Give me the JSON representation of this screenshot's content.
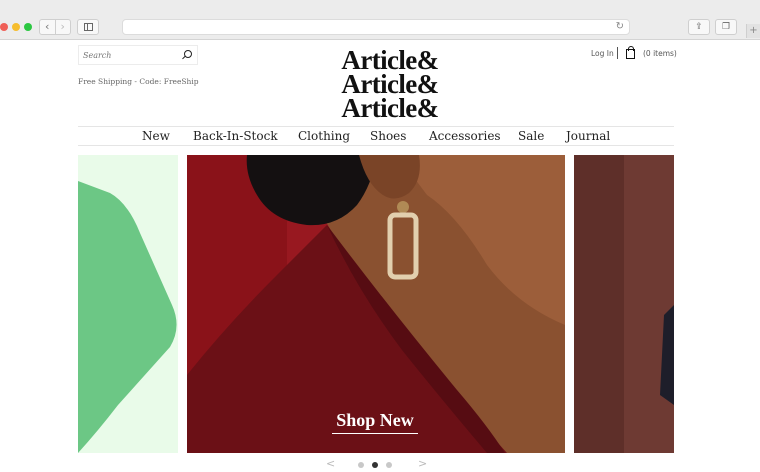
{
  "browser": {
    "back_glyph": "‹",
    "forward_glyph": "›",
    "reload_glyph": "↻",
    "share_glyph": "⇪",
    "tabs_glyph": "❐",
    "newtab_glyph": "+"
  },
  "header": {
    "search_placeholder": "Search",
    "promo_text": "Free Shipping - Code: FreeShip",
    "logo_lines": [
      "Article&",
      "Article&",
      "Article&"
    ],
    "login_label": "Log In",
    "cart_label": "(0 items)"
  },
  "nav": {
    "items": [
      "New",
      "Back-In-Stock",
      "Clothing",
      "Shoes",
      "Accessories",
      "Sale",
      "Journal"
    ]
  },
  "carousel": {
    "cta_label": "Shop New",
    "prev_glyph": "<",
    "next_glyph": ">",
    "slide_count": 3,
    "active_slide": 2
  },
  "colors": {
    "accent_green": "#6cc785",
    "slide_red": "#9b1b22",
    "slide_brown": "#6e3a33"
  }
}
